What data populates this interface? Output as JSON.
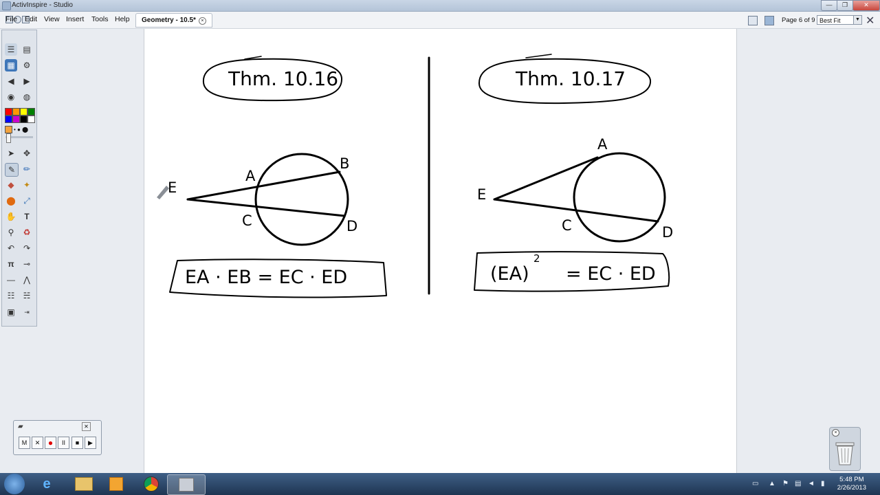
{
  "window": {
    "title": "ActivInspire - Studio",
    "controls": {
      "minimize": "—",
      "restore": "❐",
      "close": "✕"
    }
  },
  "menu": {
    "items": [
      "File",
      "Edit",
      "View",
      "Insert",
      "Tools",
      "Help"
    ]
  },
  "document_tab": {
    "label": "Geometry - 10.5*"
  },
  "page_nav": {
    "page_label": "Page 6 of 9",
    "zoom_value": "Best Fit"
  },
  "flipchart": {
    "left": {
      "theorem": "Thm. 10.16",
      "points": {
        "E": "E",
        "A": "A",
        "B": "B",
        "C": "C",
        "D": "D"
      },
      "equation": "EA · EB = EC · ED"
    },
    "right": {
      "theorem": "Thm. 10.17",
      "points": {
        "E": "E",
        "A": "A",
        "C": "C",
        "D": "D"
      },
      "equation_base": "(EA)",
      "equation_exp": "2",
      "equation_rest": "= EC · ED"
    }
  },
  "recorder": {
    "buttons": [
      "M",
      "✕",
      "●",
      "II",
      "■",
      "▶"
    ]
  },
  "taskbar": {
    "time": "5:48 PM",
    "date": "2/26/2013"
  },
  "colors": {
    "palette": [
      "#ff0000",
      "#ff9900",
      "#ffff00",
      "#008000",
      "#0000ff",
      "#cc00cc",
      "#000000",
      "#ffffff"
    ]
  }
}
